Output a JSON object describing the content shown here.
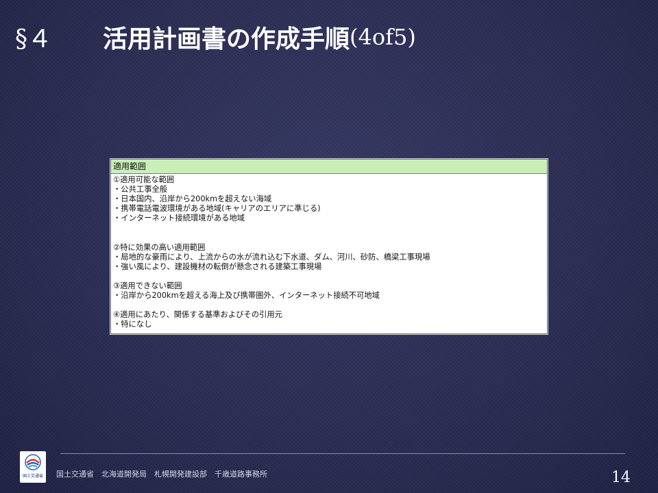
{
  "title": {
    "section_mark": "§４",
    "main": "活用計画書の作成手順",
    "suffix": "(4of5)"
  },
  "box": {
    "header": "適用範囲",
    "lines": [
      "①適用可能な範囲",
      "・公共工事全般",
      "・日本国内、沿岸から200kmを超えない海域",
      "・携帯電話電波環境がある地域(キャリアのエリアに準じる)",
      "・インターネット接続環境がある地域",
      "",
      "",
      "②特に効果の高い適用範囲",
      "・局地的な豪雨により、上流からの水が流れ込む下水道、ダム、河川、砂防、橋梁工事現場",
      "・強い風により、建設機材の転倒が懸念される建築工事現場",
      "",
      "③適用できない範囲",
      "・沿岸から200kmを超える海上及び携帯圏外、インターネット接続不可地域",
      "",
      "④適用にあたり、関係する基準およびその引用元",
      "・特になし"
    ]
  },
  "footer": {
    "logo_text": "国土交通省",
    "org": "国土交通省　北海道開発局　札幌開発建設部　千歳道路事務所",
    "page_number": "14"
  },
  "colors": {
    "background": "#2a2c52",
    "box_header": "#c9efb9",
    "logo_blue": "#1f5fbf",
    "logo_red": "#d9343b"
  },
  "icons": [
    "mlit-logo-icon"
  ]
}
